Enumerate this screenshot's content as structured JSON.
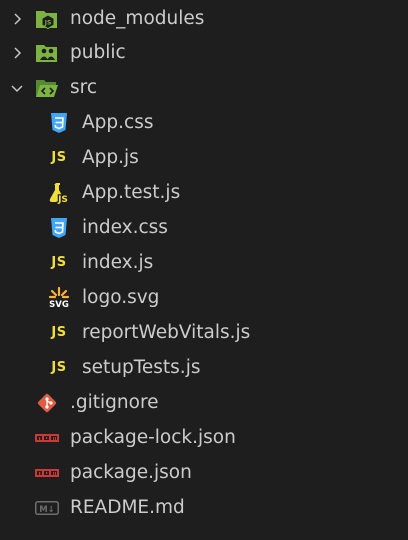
{
  "tree": {
    "node_modules": {
      "label": "node_modules",
      "icon": "folder-node-icon",
      "expanded": false
    },
    "public": {
      "label": "public",
      "icon": "folder-public-icon",
      "expanded": false
    },
    "src": {
      "label": "src",
      "icon": "folder-src-open-icon",
      "expanded": true,
      "children": [
        {
          "label": "App.css",
          "icon": "css-icon"
        },
        {
          "label": "App.js",
          "icon": "javascript-icon",
          "icon_text": "JS"
        },
        {
          "label": "App.test.js",
          "icon": "test-js-icon",
          "icon_text": "JS"
        },
        {
          "label": "index.css",
          "icon": "css-icon"
        },
        {
          "label": "index.js",
          "icon": "javascript-icon",
          "icon_text": "JS"
        },
        {
          "label": "logo.svg",
          "icon": "svg-icon",
          "icon_text": "SVG"
        },
        {
          "label": "reportWebVitals.js",
          "icon": "javascript-icon",
          "icon_text": "JS"
        },
        {
          "label": "setupTests.js",
          "icon": "javascript-icon",
          "icon_text": "JS"
        }
      ]
    },
    "root_files": [
      {
        "label": ".gitignore",
        "icon": "git-icon"
      },
      {
        "label": "package-lock.json",
        "icon": "npm-icon"
      },
      {
        "label": "package.json",
        "icon": "npm-icon"
      },
      {
        "label": "README.md",
        "icon": "markdown-icon",
        "icon_text": "M↓"
      }
    ]
  },
  "colors": {
    "background": "#1e1e1e",
    "text": "#cccccc",
    "folder_green": "#7cb342",
    "js_yellow": "#f1dd3f",
    "css_blue": "#42a5f5",
    "git_red": "#e05d44",
    "npm_red": "#cb3837",
    "svg_orange": "#ffb13b",
    "markdown_gray": "#6d6d6d"
  }
}
